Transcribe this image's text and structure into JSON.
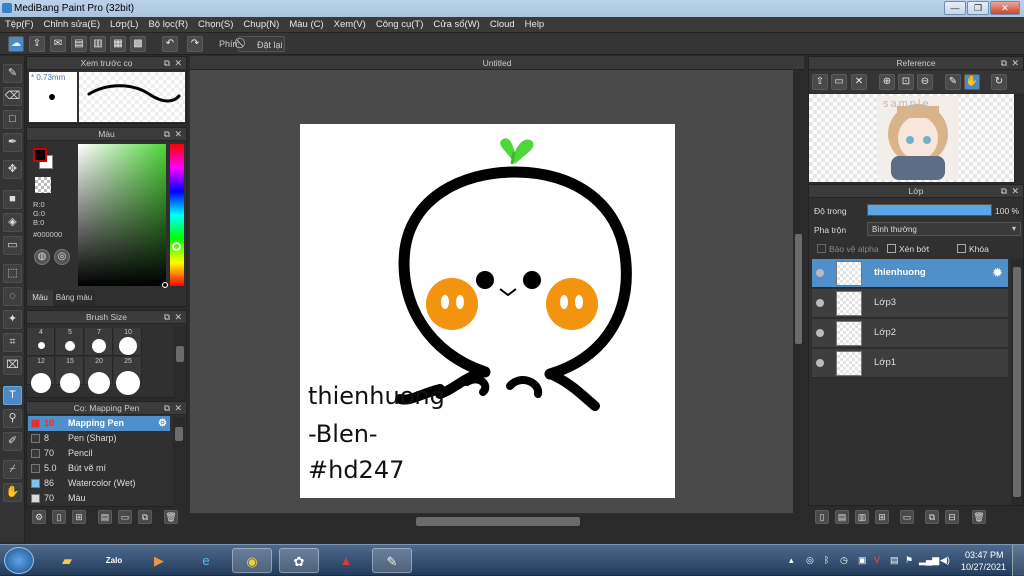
{
  "window": {
    "title": "MediBang Paint Pro (32bit)",
    "min": "—",
    "max": "❐",
    "close": "✕"
  },
  "menu": [
    "Tệp(F)",
    "Chỉnh sửa(E)",
    "Lớp(L)",
    "Bộ lọc(R)",
    "Chọn(S)",
    "Chụp(N)",
    "Màu (C)",
    "Xem(V)",
    "Công cụ(T)",
    "Cửa sổ(W)",
    "Cloud",
    "Help"
  ],
  "toolbar": {
    "shortcut_label": "Phím",
    "reset_label": "Đặt lại"
  },
  "preview_panel": {
    "title": "Xem trước cọ",
    "size": "0.73mm"
  },
  "color_panel": {
    "title": "Màu",
    "r": "R:0",
    "g": "G:0",
    "b": "B:0",
    "hex": "#000000",
    "tab_color": "Màu",
    "tab_palette": "Bảng màu",
    "fg": "#cc0000",
    "hue_selected": "#4fd63a"
  },
  "brush_size_panel": {
    "title": "Brush Size",
    "row1": [
      "4",
      "5",
      "7",
      "10"
    ],
    "row2": [
      "12",
      "15",
      "20",
      "25"
    ]
  },
  "brush_panel": {
    "title": "Cọ: Mapping Pen",
    "items": [
      {
        "size": "10",
        "name": "Mapping Pen",
        "color": "#e03030",
        "selected": true
      },
      {
        "size": "8",
        "name": "Pen (Sharp)",
        "color": "#3a3a3a",
        "selected": false
      },
      {
        "size": "70",
        "name": "Pencil",
        "color": "#3a3a3a",
        "selected": false
      },
      {
        "size": "5.0",
        "name": "Bút vẽ mí",
        "color": "#3a3a3a",
        "selected": false
      },
      {
        "size": "86",
        "name": "Watercolor (Wet)",
        "color": "#7ec3f0",
        "selected": false
      },
      {
        "size": "70",
        "name": "Màu",
        "color": "#d8d8d8",
        "selected": false
      }
    ]
  },
  "canvas": {
    "tab": "Untitled",
    "text_lines": [
      "thienhuong",
      "-Blen-",
      "#hd247"
    ]
  },
  "reference_panel": {
    "title": "Reference",
    "watermark": "sample"
  },
  "layer_panel": {
    "title": "Lớp",
    "opacity_label": "Độ trong",
    "opacity_value": "100 %",
    "opacity_fraction": 1.0,
    "blend_label": "Pha trộn",
    "blend_value": "Bình thường",
    "protect_alpha": "Bảo vệ alpha",
    "clip": "Xén bớt",
    "lock": "Khóa",
    "layers": [
      {
        "name": "thienhuong",
        "selected": true
      },
      {
        "name": "Lớp3",
        "selected": false
      },
      {
        "name": "Lớp2",
        "selected": false
      },
      {
        "name": "Lớp1",
        "selected": false
      }
    ]
  },
  "taskbar": {
    "zalo": "Zalo",
    "time": "03:47 PM",
    "date": "10/27/2021"
  }
}
